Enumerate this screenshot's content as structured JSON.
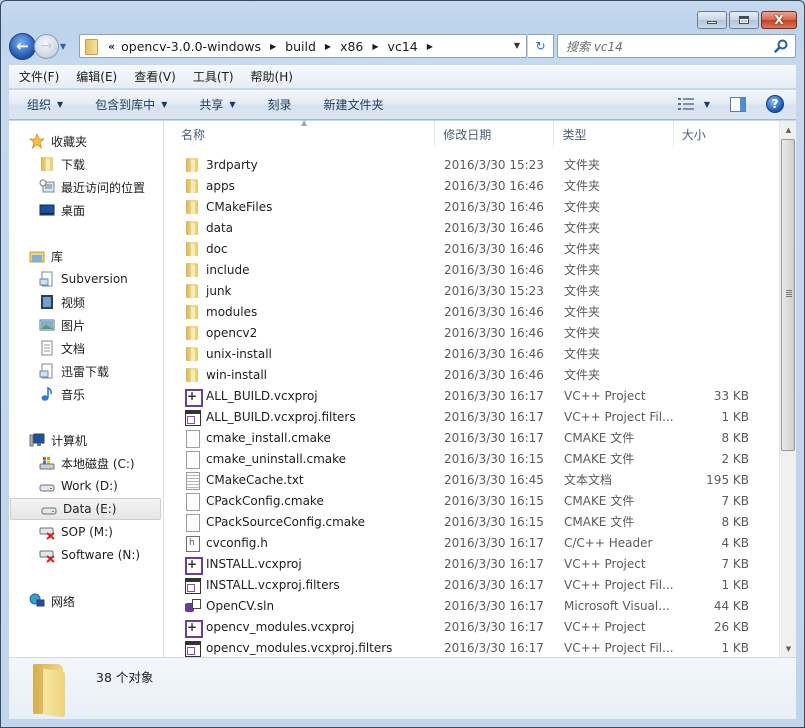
{
  "window": {
    "caption_buttons": [
      {
        "name": "minimize",
        "icon": "minimize-icon"
      },
      {
        "name": "maximize",
        "icon": "maximize-icon"
      },
      {
        "name": "close",
        "icon": "close-icon",
        "glyph": "X"
      }
    ]
  },
  "nav": {
    "back_icon": "arrow-left-icon",
    "forward_icon": "arrow-right-icon",
    "back_glyph": "←",
    "forward_glyph": "→",
    "recent_glyph": "▼"
  },
  "address": {
    "overflow": "«",
    "crumbs": [
      "opencv-3.0.0-windows",
      "build",
      "x86",
      "vc14"
    ],
    "separator_glyph": "▶",
    "dropdown_glyph": "▼",
    "refresh_glyph": "↻"
  },
  "search": {
    "placeholder": "搜索 vc14"
  },
  "menu": {
    "items": [
      "文件(F)",
      "编辑(E)",
      "查看(V)",
      "工具(T)",
      "帮助(H)"
    ]
  },
  "toolbar": {
    "organize": "组织",
    "include_in_library": "包含到库中",
    "share": "共享",
    "burn": "刻录",
    "new_folder": "新建文件夹",
    "caret": "▼",
    "help_glyph": "?"
  },
  "sidebar": {
    "favorites": {
      "label": "收藏夹",
      "icon": "star-icon",
      "items": [
        {
          "label": "下载",
          "icon": "downloads-folder-icon"
        },
        {
          "label": "最近访问的位置",
          "icon": "recent-places-icon"
        },
        {
          "label": "桌面",
          "icon": "desktop-icon"
        }
      ]
    },
    "libraries": {
      "label": "库",
      "icon": "library-icon",
      "items": [
        {
          "label": "Subversion",
          "icon": "document-library-icon"
        },
        {
          "label": "视频",
          "icon": "video-icon"
        },
        {
          "label": "图片",
          "icon": "pictures-icon"
        },
        {
          "label": "文档",
          "icon": "documents-icon"
        },
        {
          "label": "迅雷下载",
          "icon": "document-library-icon"
        },
        {
          "label": "音乐",
          "icon": "music-icon"
        }
      ]
    },
    "computer": {
      "label": "计算机",
      "icon": "computer-icon",
      "items": [
        {
          "label": "本地磁盘 (C:)",
          "icon": "system-drive-icon"
        },
        {
          "label": "Work (D:)",
          "icon": "drive-icon"
        },
        {
          "label": "Data (E:)",
          "icon": "drive-icon",
          "selected": true
        },
        {
          "label": "SOP (M:)",
          "icon": "disconnected-drive-icon"
        },
        {
          "label": "Software (N:)",
          "icon": "disconnected-drive-icon"
        }
      ]
    },
    "network": {
      "label": "网络",
      "icon": "network-icon"
    }
  },
  "columns": {
    "name": "名称",
    "date": "修改日期",
    "type": "类型",
    "size": "大小",
    "sort_glyph": "▲"
  },
  "files": [
    {
      "name": "3rdparty",
      "date": "2016/3/30 15:23",
      "type": "文件夹",
      "size": "",
      "icon": "folder"
    },
    {
      "name": "apps",
      "date": "2016/3/30 16:46",
      "type": "文件夹",
      "size": "",
      "icon": "folder"
    },
    {
      "name": "CMakeFiles",
      "date": "2016/3/30 16:46",
      "type": "文件夹",
      "size": "",
      "icon": "folder"
    },
    {
      "name": "data",
      "date": "2016/3/30 16:46",
      "type": "文件夹",
      "size": "",
      "icon": "folder"
    },
    {
      "name": "doc",
      "date": "2016/3/30 16:46",
      "type": "文件夹",
      "size": "",
      "icon": "folder"
    },
    {
      "name": "include",
      "date": "2016/3/30 16:46",
      "type": "文件夹",
      "size": "",
      "icon": "folder"
    },
    {
      "name": "junk",
      "date": "2016/3/30 15:23",
      "type": "文件夹",
      "size": "",
      "icon": "folder"
    },
    {
      "name": "modules",
      "date": "2016/3/30 16:46",
      "type": "文件夹",
      "size": "",
      "icon": "folder"
    },
    {
      "name": "opencv2",
      "date": "2016/3/30 16:46",
      "type": "文件夹",
      "size": "",
      "icon": "folder"
    },
    {
      "name": "unix-install",
      "date": "2016/3/30 16:46",
      "type": "文件夹",
      "size": "",
      "icon": "folder"
    },
    {
      "name": "win-install",
      "date": "2016/3/30 16:46",
      "type": "文件夹",
      "size": "",
      "icon": "folder"
    },
    {
      "name": "ALL_BUILD.vcxproj",
      "date": "2016/3/30 16:17",
      "type": "VC++ Project",
      "size": "33 KB",
      "icon": "proj"
    },
    {
      "name": "ALL_BUILD.vcxproj.filters",
      "date": "2016/3/30 16:17",
      "type": "VC++ Project Fil...",
      "size": "1 KB",
      "icon": "filters"
    },
    {
      "name": "cmake_install.cmake",
      "date": "2016/3/30 16:17",
      "type": "CMAKE 文件",
      "size": "8 KB",
      "icon": "file"
    },
    {
      "name": "cmake_uninstall.cmake",
      "date": "2016/3/30 16:15",
      "type": "CMAKE 文件",
      "size": "2 KB",
      "icon": "file"
    },
    {
      "name": "CMakeCache.txt",
      "date": "2016/3/30 16:45",
      "type": "文本文档",
      "size": "195 KB",
      "icon": "txt"
    },
    {
      "name": "CPackConfig.cmake",
      "date": "2016/3/30 16:15",
      "type": "CMAKE 文件",
      "size": "7 KB",
      "icon": "file"
    },
    {
      "name": "CPackSourceConfig.cmake",
      "date": "2016/3/30 16:15",
      "type": "CMAKE 文件",
      "size": "8 KB",
      "icon": "file"
    },
    {
      "name": "cvconfig.h",
      "date": "2016/3/30 16:17",
      "type": "C/C++ Header",
      "size": "4 KB",
      "icon": "header"
    },
    {
      "name": "INSTALL.vcxproj",
      "date": "2016/3/30 16:17",
      "type": "VC++ Project",
      "size": "7 KB",
      "icon": "proj"
    },
    {
      "name": "INSTALL.vcxproj.filters",
      "date": "2016/3/30 16:17",
      "type": "VC++ Project Fil...",
      "size": "1 KB",
      "icon": "filters"
    },
    {
      "name": "OpenCV.sln",
      "date": "2016/3/30 16:17",
      "type": "Microsoft Visual...",
      "size": "44 KB",
      "icon": "sln"
    },
    {
      "name": "opencv_modules.vcxproj",
      "date": "2016/3/30 16:17",
      "type": "VC++ Project",
      "size": "26 KB",
      "icon": "proj"
    },
    {
      "name": "opencv_modules.vcxproj.filters",
      "date": "2016/3/30 16:17",
      "type": "VC++ Project Fil...",
      "size": "1 KB",
      "icon": "filters"
    }
  ],
  "scrollbar": {
    "up_glyph": "▲",
    "down_glyph": "▼"
  },
  "details": {
    "count": "38 个对象"
  }
}
